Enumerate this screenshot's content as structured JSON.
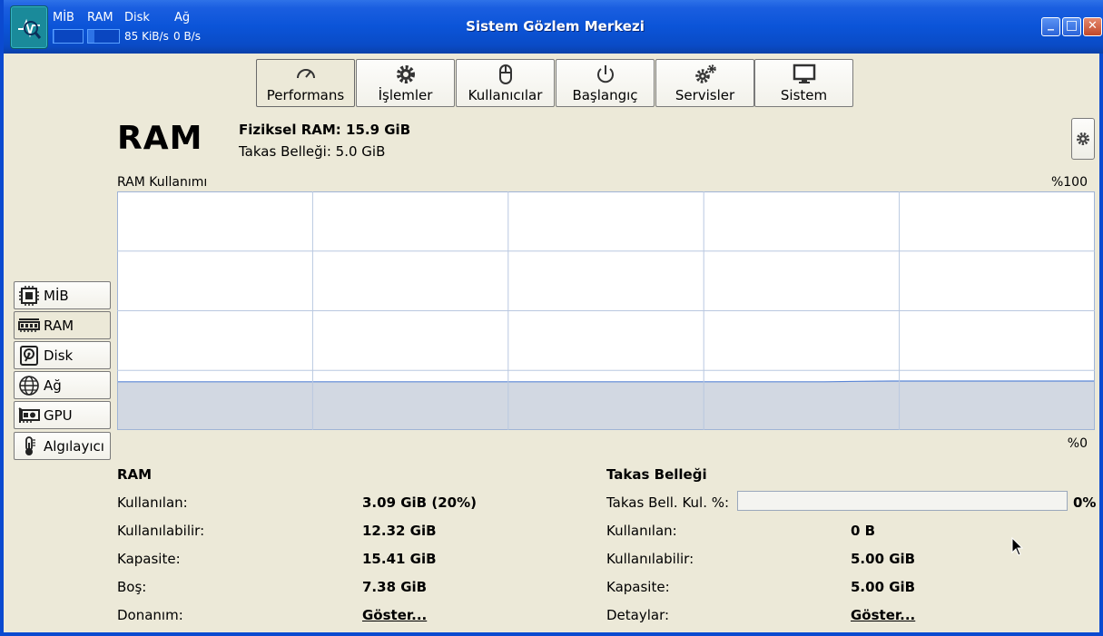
{
  "window": {
    "title": "Sistem Gözlem Merkezi",
    "minimize_label": "_",
    "maximize_label": "□",
    "close_label": "✕"
  },
  "mini_monitor": {
    "cpu_label": "MİB",
    "ram_label": "RAM",
    "disk_label": "Disk",
    "net_label": "Ağ",
    "disk_value": "85 KiB/s",
    "net_value": "0 B/s",
    "cpu_fill": 0.04,
    "ram_fill": 0.2
  },
  "tabs": [
    {
      "label": "Performans",
      "icon": "gauge-icon",
      "active": true
    },
    {
      "label": "İşlemler",
      "icon": "gear-icon",
      "active": false
    },
    {
      "label": "Kullanıcılar",
      "icon": "mouse-icon",
      "active": false
    },
    {
      "label": "Başlangıç",
      "icon": "power-icon",
      "active": false
    },
    {
      "label": "Servisler",
      "icon": "gears-icon",
      "active": false
    },
    {
      "label": "Sistem",
      "icon": "monitor-icon",
      "active": false
    }
  ],
  "header": {
    "title": "RAM",
    "physical_ram": "Fiziksel RAM: 15.9 GiB",
    "swap": "Takas Belleği: 5.0 GiB"
  },
  "chart": {
    "label": "RAM Kullanımı",
    "max_label": "%100",
    "min_label": "%0"
  },
  "chart_data": {
    "type": "area",
    "title": "RAM Kullanımı",
    "ylim": [
      0,
      100
    ],
    "grid": true,
    "series": [
      {
        "values": [
          20,
          20,
          20,
          20,
          20,
          20,
          20,
          20,
          20,
          20,
          20,
          20,
          20,
          20,
          20,
          20,
          20,
          20,
          20,
          20,
          20,
          20,
          20.2,
          20.3,
          20.3,
          20.3,
          20.3,
          20.3,
          20.3,
          20.3
        ]
      }
    ],
    "fill_color": "#d2d8e2",
    "line_color": "#5b86d6"
  },
  "sidebar": {
    "items": [
      {
        "label": "MİB",
        "icon": "cpu-icon",
        "active": false
      },
      {
        "label": "RAM",
        "icon": "ram-icon",
        "active": true
      },
      {
        "label": "Disk",
        "icon": "disk-icon",
        "active": false
      },
      {
        "label": "Ağ",
        "icon": "globe-icon",
        "active": false
      },
      {
        "label": "GPU",
        "icon": "gpu-icon",
        "active": false
      },
      {
        "label": "Algılayıcı",
        "icon": "thermometer-icon",
        "active": false
      }
    ]
  },
  "ram_stats": {
    "title": "RAM",
    "used_label": "Kullanılan:",
    "used_value": "3.09 GiB (20%)",
    "available_label": "Kullanılabilir:",
    "available_value": "12.32 GiB",
    "capacity_label": "Kapasite:",
    "capacity_value": "15.41 GiB",
    "free_label": "Boş:",
    "free_value": "7.38 GiB",
    "hardware_label": "Donanım:",
    "hardware_link": "Göster..."
  },
  "swap_stats": {
    "title": "Takas Belleği",
    "usage_label": "Takas Bell. Kul. %:",
    "usage_percent": "0%",
    "usage_fill": 0,
    "used_label": "Kullanılan:",
    "used_value": "0 B",
    "available_label": "Kullanılabilir:",
    "available_value": "5.00 GiB",
    "capacity_label": "Kapasite:",
    "capacity_value": "5.00 GiB",
    "details_label": "Detaylar:",
    "details_link": "Göster..."
  }
}
